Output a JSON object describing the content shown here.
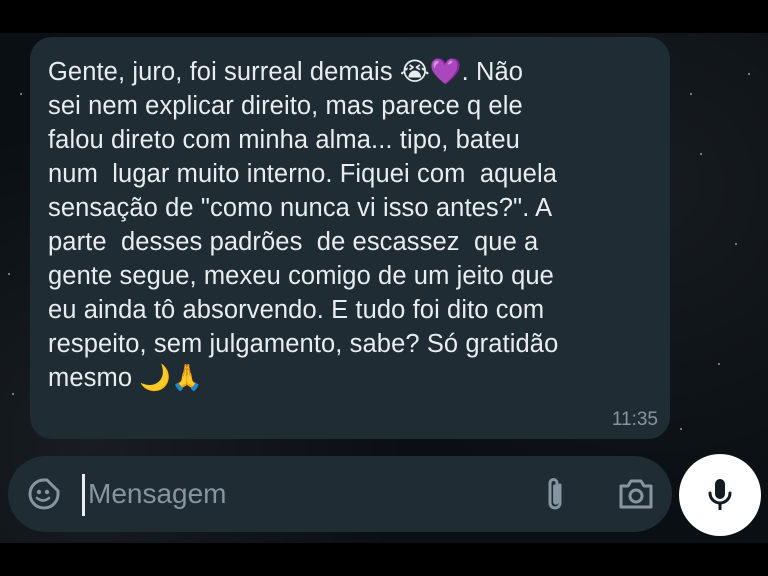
{
  "message": {
    "lines": [
      "Gente, juro, foi surreal demais ",
      "sei nem explicar direito, mas parece q ele",
      "falou direto com minha alma... tipo, bateu",
      "num  lugar muito interno. Fiquei com  aquela",
      "sensação de \"como nunca vi isso antes?\". A",
      "parte  desses padrões  de escassez  que a",
      "gente segue, mexeu comigo de um jeito que",
      "eu ainda tô absorvendo. E tudo foi dito com",
      "respeito, sem julgamento, sabe? Só gratidão",
      "mesmo "
    ],
    "line1_emojis": "😭💜",
    "line1_tail": ". Não",
    "last_emojis": "🌙🙏",
    "time": "11:35"
  },
  "composer": {
    "placeholder": "Mensagem",
    "icons": {
      "sticker": "sticker-icon",
      "attach": "paperclip-icon",
      "camera": "camera-icon",
      "mic": "microphone-icon"
    }
  },
  "colors": {
    "bubble": "#1f2c33",
    "text": "#e9edef",
    "muted": "#8696a0",
    "mic_button": "#ffffff"
  }
}
